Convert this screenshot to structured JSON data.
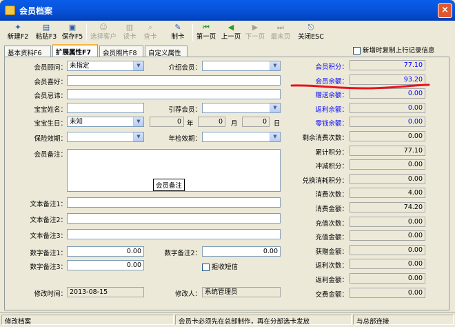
{
  "window": {
    "title": "会员档案",
    "close": "×"
  },
  "toolbar": [
    {
      "label": "新建F2",
      "icon": "new-doc-icon",
      "glyph": "✦",
      "enabled": true
    },
    {
      "label": "粘贴F3",
      "icon": "paste-icon",
      "glyph": "▤",
      "enabled": true
    },
    {
      "label": "保存F5",
      "icon": "save-icon",
      "glyph": "▣",
      "enabled": true
    },
    {
      "label": "选择客户",
      "icon": "select-customer-icon",
      "glyph": "☺",
      "enabled": false
    },
    {
      "label": "读卡",
      "icon": "barcode-icon",
      "glyph": "▥",
      "enabled": false
    },
    {
      "label": "查卡",
      "icon": "search-card-icon",
      "glyph": "⌕",
      "enabled": false
    },
    {
      "label": "制卡",
      "icon": "make-card-icon",
      "glyph": "✎",
      "enabled": true
    },
    {
      "label": "第一页",
      "icon": "first-page-icon",
      "glyph": "⏮",
      "enabled": true
    },
    {
      "label": "上一页",
      "icon": "prev-page-icon",
      "glyph": "◀",
      "enabled": true
    },
    {
      "label": "下一页",
      "icon": "next-page-icon",
      "glyph": "▶",
      "enabled": false
    },
    {
      "label": "最末页",
      "icon": "last-page-icon",
      "glyph": "⏭",
      "enabled": false
    },
    {
      "label": "关闭ESC",
      "icon": "close-door-icon",
      "glyph": "⎋",
      "enabled": true
    }
  ],
  "tabs": [
    "基本资料F6",
    "扩展属性F7",
    "会员照片F8",
    "自定义属性"
  ],
  "active_tab": 1,
  "copy_prev": "新增时复制上行记录信息",
  "form": {
    "consultant": {
      "label": "会员顾问：",
      "value": "未指定"
    },
    "referrer": {
      "label": "介绍会员：",
      "value": ""
    },
    "hobby": {
      "label": "会员喜好：",
      "value": ""
    },
    "taboo": {
      "label": "会员忌讳：",
      "value": ""
    },
    "baby_name": {
      "label": "宝宝姓名：",
      "value": ""
    },
    "guide_member": {
      "label": "引荐会员：",
      "value": ""
    },
    "baby_birthday": {
      "label": "宝宝生日：",
      "value": "未知"
    },
    "year": {
      "value": "0",
      "unit": "年"
    },
    "month": {
      "value": "0",
      "unit": "月"
    },
    "day": {
      "value": "0",
      "unit": "日"
    },
    "insurance": {
      "label": "保险效期：",
      "value": ""
    },
    "annual_check": {
      "label": "年检效期：",
      "value": ""
    },
    "remark": {
      "label": "会员备注：",
      "caption": "会员备注"
    },
    "text1": {
      "label": "文本备注1：",
      "value": ""
    },
    "text2": {
      "label": "文本备注2：",
      "value": ""
    },
    "text3": {
      "label": "文本备注3：",
      "value": ""
    },
    "num1": {
      "label": "数字备注1：",
      "value": "0.00"
    },
    "num2": {
      "label": "数字备注2：",
      "value": "0.00"
    },
    "num3": {
      "label": "数字备注3：",
      "value": "0.00"
    },
    "reject_sms": "拒收短信",
    "modified_time": {
      "label": "修改时间：",
      "value": "2013-08-15"
    },
    "modified_by": {
      "label": "修改人：",
      "value": "系统管理员"
    }
  },
  "stats": [
    {
      "label": "会员积分：",
      "value": "77.10",
      "blue": true
    },
    {
      "label": "会员余额：",
      "value": "93.20",
      "blue": true
    },
    {
      "label": "赠送余额：",
      "value": "0.00",
      "blue": true
    },
    {
      "label": "返利余额：",
      "value": "0.00",
      "blue": true
    },
    {
      "label": "零钱余额：",
      "value": "0.00",
      "blue": true
    },
    {
      "label": "剩余消费次数：",
      "value": "0.00",
      "blue": false
    },
    {
      "label": "累计积分：",
      "value": "77.10",
      "blue": false
    },
    {
      "label": "冲减积分：",
      "value": "0.00",
      "blue": false
    },
    {
      "label": "兑换消耗积分：",
      "value": "0.00",
      "blue": false
    },
    {
      "label": "消费次数：",
      "value": "4.00",
      "blue": false
    },
    {
      "label": "消费金额：",
      "value": "74.20",
      "blue": false
    },
    {
      "label": "充值次数：",
      "value": "0.00",
      "blue": false
    },
    {
      "label": "充值金额：",
      "value": "0.00",
      "blue": false
    },
    {
      "label": "获赠金额：",
      "value": "0.00",
      "blue": false
    },
    {
      "label": "返利次数：",
      "value": "0.00",
      "blue": false
    },
    {
      "label": "返利金额：",
      "value": "0.00",
      "blue": false
    },
    {
      "label": "交费金额：",
      "value": "0.00",
      "blue": false
    }
  ],
  "colors": {
    "highlight": "#e8141c",
    "link": "#0000ff"
  },
  "status": [
    "修改档案",
    "会员卡必须先在总部制作，再在分部选卡发放",
    "与总部连接"
  ]
}
